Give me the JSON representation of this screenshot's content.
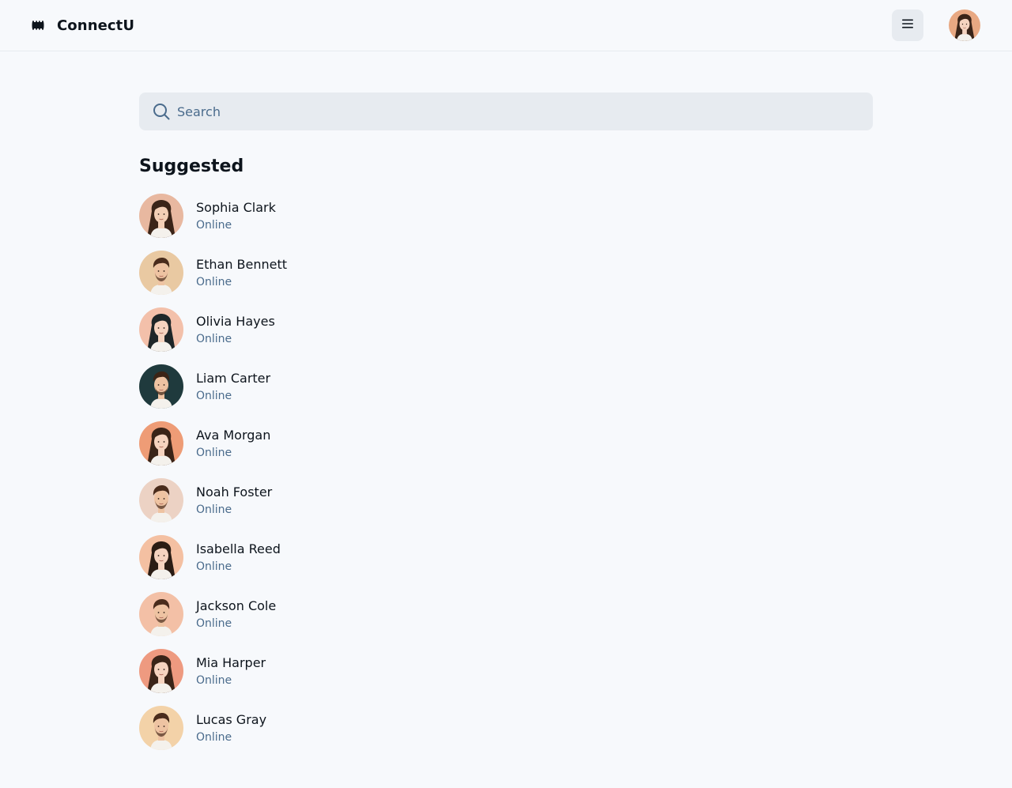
{
  "header": {
    "app_title": "ConnectU",
    "logo_icon": "connectu-logo-icon",
    "menu_icon": "hamburger-menu-icon"
  },
  "search": {
    "placeholder": "Search",
    "value": ""
  },
  "suggested": {
    "title": "Suggested",
    "users": [
      {
        "name": "Sophia Clark",
        "status": "Online",
        "bg": "#e8b8a0",
        "hair": "#3a2418",
        "skin": "#f3cfb6",
        "gender": "f"
      },
      {
        "name": "Ethan Bennett",
        "status": "Online",
        "bg": "#e9c9a2",
        "hair": "#4a2c1c",
        "skin": "#eec3a2",
        "gender": "m"
      },
      {
        "name": "Olivia Hayes",
        "status": "Online",
        "bg": "#f3c0aa",
        "hair": "#1e2628",
        "skin": "#f5d3bf",
        "gender": "f"
      },
      {
        "name": "Liam Carter",
        "status": "Online",
        "bg": "#1f3a3d",
        "hair": "#3b2416",
        "skin": "#eec3a2",
        "gender": "m"
      },
      {
        "name": "Ava Morgan",
        "status": "Online",
        "bg": "#ee9c76",
        "hair": "#3a2418",
        "skin": "#f5d3bf",
        "gender": "f"
      },
      {
        "name": "Noah Foster",
        "status": "Online",
        "bg": "#ecd2c4",
        "hair": "#4a2c1c",
        "skin": "#eec3a2",
        "gender": "m"
      },
      {
        "name": "Isabella Reed",
        "status": "Online",
        "bg": "#f4c0a2",
        "hair": "#2a1c14",
        "skin": "#f5d3bf",
        "gender": "f"
      },
      {
        "name": "Jackson Cole",
        "status": "Online",
        "bg": "#f3c0a6",
        "hair": "#4a2c1c",
        "skin": "#eec3a2",
        "gender": "m"
      },
      {
        "name": "Mia Harper",
        "status": "Online",
        "bg": "#ee9a80",
        "hair": "#3a2418",
        "skin": "#f5d3bf",
        "gender": "f"
      },
      {
        "name": "Lucas Gray",
        "status": "Online",
        "bg": "#f3d2a8",
        "hair": "#4a2c1c",
        "skin": "#eec3a2",
        "gender": "m"
      }
    ]
  },
  "header_avatar": {
    "bg": "#e8a882",
    "hair": "#3a2418",
    "skin": "#f5d3bf",
    "gender": "f"
  },
  "colors": {
    "background": "#f7f9fc",
    "surface": "#e7ebf0",
    "text_primary": "#0d141c",
    "text_secondary": "#4a6b8c"
  }
}
